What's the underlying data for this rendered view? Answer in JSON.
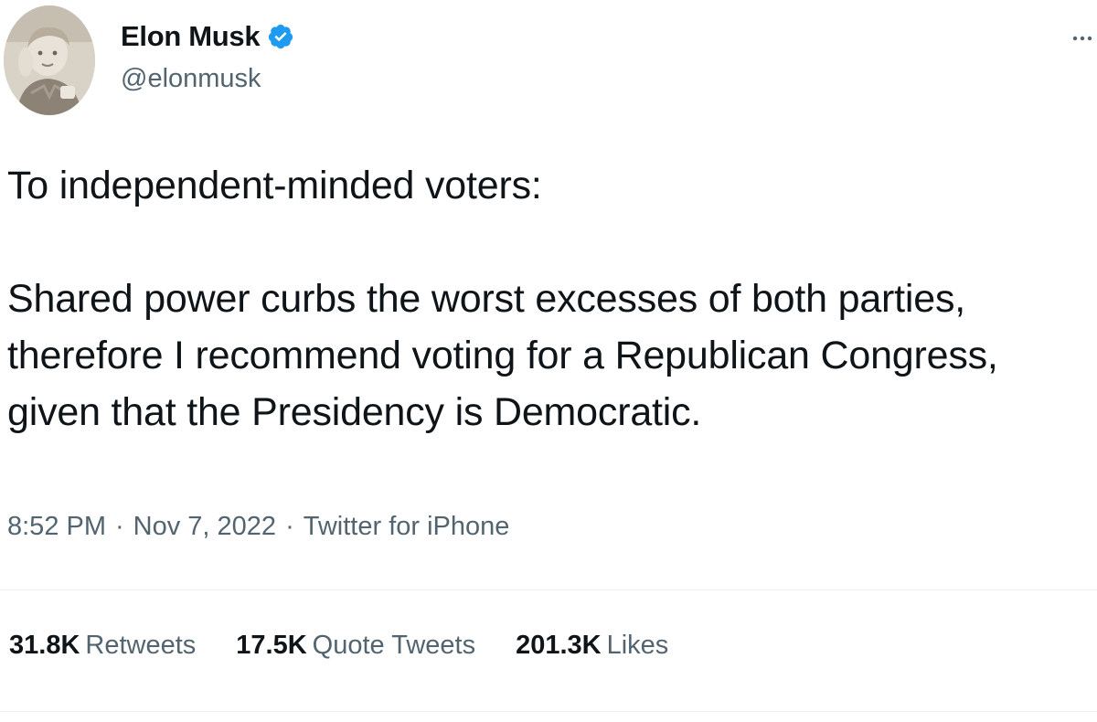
{
  "author": {
    "name": "Elon Musk",
    "handle": "@elonmusk",
    "verified": true,
    "avatar_icon": "profile-photo-avatar",
    "verified_color": "#1d9bf0"
  },
  "menu": {
    "more_icon": "more-options-icon"
  },
  "tweet": {
    "paragraphs": [
      "To independent-minded voters:",
      "Shared power curbs the worst excesses of both parties, therefore I recommend voting for a Republican Congress, given that the Presidency is Democratic."
    ]
  },
  "meta": {
    "time": "8:52 PM",
    "separator": "·",
    "date": "Nov 7, 2022",
    "source": "Twitter for iPhone"
  },
  "stats": {
    "retweets": {
      "count": "31.8K",
      "label": "Retweets"
    },
    "quotes": {
      "count": "17.5K",
      "label": "Quote Tweets"
    },
    "likes": {
      "count": "201.3K",
      "label": "Likes"
    }
  },
  "colors": {
    "text": "#0f1419",
    "secondary_text": "#536471",
    "divider": "#eff3f4",
    "accent": "#1d9bf0"
  }
}
